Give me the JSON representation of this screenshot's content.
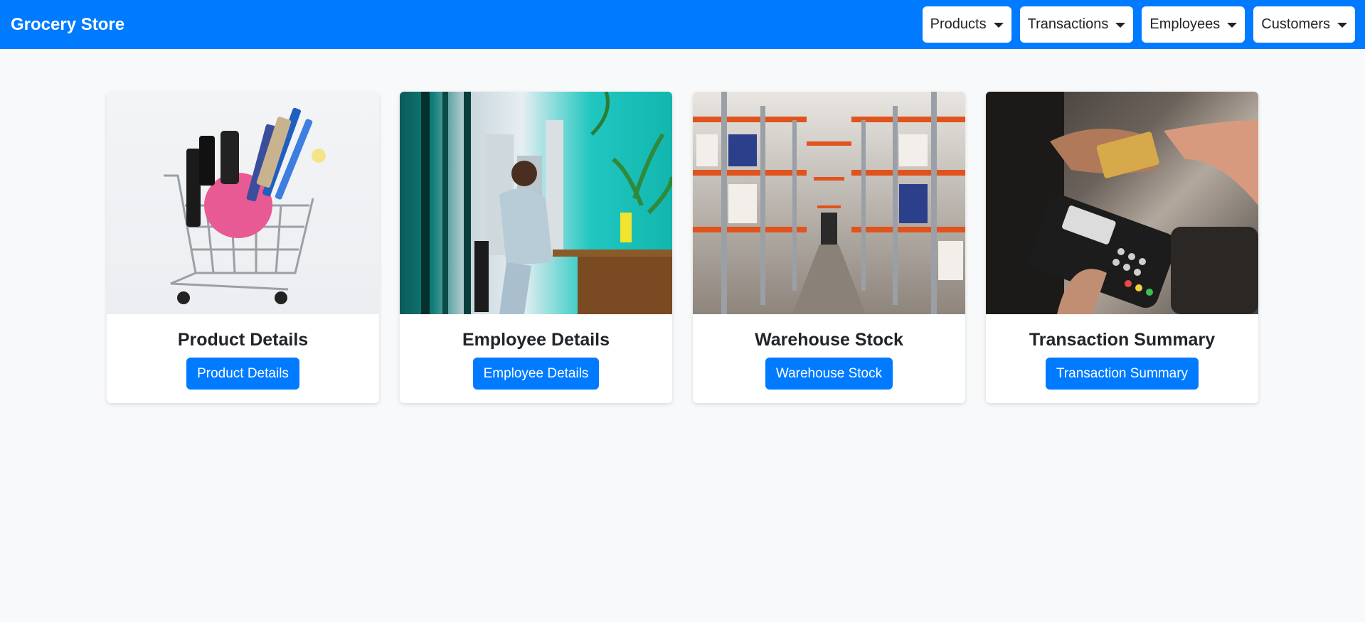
{
  "navbar": {
    "brand": "Grocery Store",
    "menus": [
      {
        "label": "Products"
      },
      {
        "label": "Transactions"
      },
      {
        "label": "Employees"
      },
      {
        "label": "Customers"
      }
    ]
  },
  "cards": [
    {
      "title": "Product Details",
      "button": "Product Details",
      "image": "shopping-cart-photo"
    },
    {
      "title": "Employee Details",
      "button": "Employee Details",
      "image": "office-worker-photo"
    },
    {
      "title": "Warehouse Stock",
      "button": "Warehouse Stock",
      "image": "warehouse-aisle-photo"
    },
    {
      "title": "Transaction Summary",
      "button": "Transaction Summary",
      "image": "card-payment-photo"
    }
  ],
  "colors": {
    "primary": "#007bff",
    "background": "#f8f9fa",
    "card": "#ffffff"
  }
}
